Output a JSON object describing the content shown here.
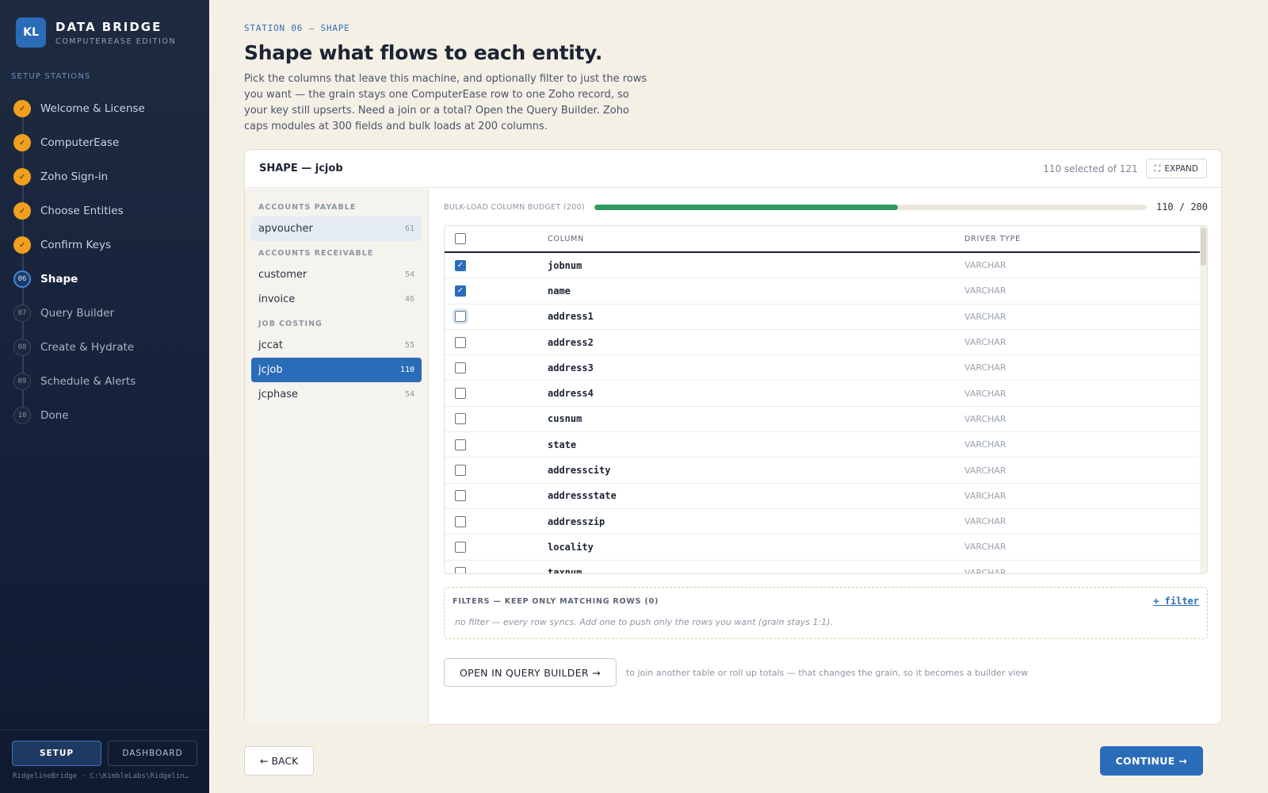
{
  "brand": {
    "badge": "KL",
    "title": "DATA BRIDGE",
    "subtitle": "COMPUTEREASE EDITION"
  },
  "sidebar": {
    "section_label": "SETUP STATIONS",
    "steps": [
      {
        "marker": "✓",
        "label": "Welcome & License",
        "state": "done"
      },
      {
        "marker": "✓",
        "label": "ComputerEase",
        "state": "done"
      },
      {
        "marker": "✓",
        "label": "Zoho Sign-in",
        "state": "done"
      },
      {
        "marker": "✓",
        "label": "Choose Entities",
        "state": "done"
      },
      {
        "marker": "✓",
        "label": "Confirm Keys",
        "state": "done"
      },
      {
        "marker": "06",
        "label": "Shape",
        "state": "current"
      },
      {
        "marker": "07",
        "label": "Query Builder",
        "state": "todo"
      },
      {
        "marker": "08",
        "label": "Create & Hydrate",
        "state": "todo"
      },
      {
        "marker": "09",
        "label": "Schedule & Alerts",
        "state": "todo"
      },
      {
        "marker": "10",
        "label": "Done",
        "state": "todo"
      }
    ],
    "mode_setup": "SETUP",
    "mode_dashboard": "DASHBOARD",
    "footer": "RidgelineBridge · C:\\KimbleLabs\\Ridgelin…"
  },
  "page": {
    "eyebrow": "STATION 06 — SHAPE",
    "title": "Shape what flows to each entity.",
    "intro": "Pick the columns that leave this machine, and optionally filter to just the rows you want — the grain stays one ComputerEase row to one Zoho record, so your key still upserts. Need a join or a total? Open the Query Builder. Zoho caps modules at 300 fields and bulk loads at 200 columns."
  },
  "card": {
    "title": "SHAPE — jcjob",
    "selected_count": "110 selected of 121",
    "expand_label": "EXPAND",
    "expand_icon": "expand-icon"
  },
  "entities": {
    "groups": [
      {
        "label": "ACCOUNTS PAYABLE",
        "items": [
          {
            "name": "apvoucher",
            "count": "61",
            "state": "soft"
          }
        ]
      },
      {
        "label": "ACCOUNTS RECEIVABLE",
        "items": [
          {
            "name": "customer",
            "count": "54",
            "state": ""
          },
          {
            "name": "invoice",
            "count": "46",
            "state": ""
          }
        ]
      },
      {
        "label": "JOB COSTING",
        "items": [
          {
            "name": "jccat",
            "count": "55",
            "state": ""
          },
          {
            "name": "jcjob",
            "count": "110",
            "state": "selected"
          },
          {
            "name": "jcphase",
            "count": "54",
            "state": ""
          }
        ]
      }
    ]
  },
  "budget": {
    "label": "BULK-LOAD COLUMN BUDGET (200)",
    "used": 110,
    "max": 200,
    "value_text": "110 / 200",
    "color": "#2f9a60"
  },
  "table": {
    "header_column": "COLUMN",
    "header_type": "DRIVER TYPE",
    "rows": [
      {
        "name": "jobnum",
        "type": "VARCHAR",
        "checked": true
      },
      {
        "name": "name",
        "type": "VARCHAR",
        "checked": true
      },
      {
        "name": "address1",
        "type": "VARCHAR",
        "checked": false,
        "focused": true
      },
      {
        "name": "address2",
        "type": "VARCHAR",
        "checked": false
      },
      {
        "name": "address3",
        "type": "VARCHAR",
        "checked": false
      },
      {
        "name": "address4",
        "type": "VARCHAR",
        "checked": false
      },
      {
        "name": "cusnum",
        "type": "VARCHAR",
        "checked": false
      },
      {
        "name": "state",
        "type": "VARCHAR",
        "checked": false
      },
      {
        "name": "addresscity",
        "type": "VARCHAR",
        "checked": false
      },
      {
        "name": "addressstate",
        "type": "VARCHAR",
        "checked": false
      },
      {
        "name": "addresszip",
        "type": "VARCHAR",
        "checked": false
      },
      {
        "name": "locality",
        "type": "VARCHAR",
        "checked": false
      },
      {
        "name": "taxnum",
        "type": "VARCHAR",
        "checked": false
      }
    ]
  },
  "filters": {
    "title": "FILTERS — KEEP ONLY MATCHING ROWS (0)",
    "add_label": "+ filter",
    "empty_text": "no filter — every row syncs. Add one to push only the rows you want (grain stays 1:1)."
  },
  "query_builder": {
    "button_label": "OPEN IN QUERY BUILDER →",
    "hint": "to join another table or roll up totals — that changes the grain, so it becomes a builder view"
  },
  "nav": {
    "back_label": "← BACK",
    "continue_label": "CONTINUE →"
  }
}
